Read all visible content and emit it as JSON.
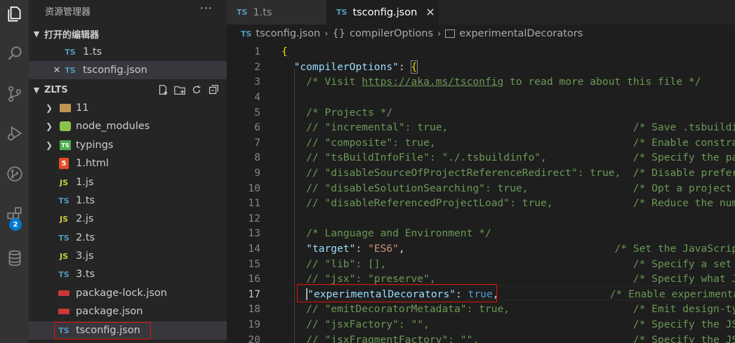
{
  "activity_bar": {
    "icons": [
      "files-icon",
      "search-icon",
      "source-control-icon",
      "run-debug-icon",
      "remote-icon",
      "extensions-icon",
      "database-icon"
    ],
    "extensions_badge": "2"
  },
  "sidebar": {
    "title": "资源管理器",
    "more": "···",
    "open_editors": {
      "title": "打开的编辑器",
      "items": [
        {
          "icon": "TS",
          "label": "1.ts"
        },
        {
          "icon": "TS",
          "label": "tsconfig.json",
          "close": "✕"
        }
      ]
    },
    "folder": {
      "title": "ZLTS",
      "items": [
        {
          "type": "folder",
          "label": "11"
        },
        {
          "type": "folder-node",
          "label": "node_modules"
        },
        {
          "type": "folder-typings",
          "label": "typings"
        },
        {
          "type": "html",
          "icon": "5",
          "label": "1.html"
        },
        {
          "type": "js",
          "icon": "JS",
          "label": "1.js"
        },
        {
          "type": "ts",
          "icon": "TS",
          "label": "1.ts"
        },
        {
          "type": "js",
          "icon": "JS",
          "label": "2.js"
        },
        {
          "type": "ts",
          "icon": "TS",
          "label": "2.ts"
        },
        {
          "type": "js",
          "icon": "JS",
          "label": "3.js"
        },
        {
          "type": "ts",
          "icon": "TS",
          "label": "3.ts"
        },
        {
          "type": "npm",
          "label": "package-lock.json"
        },
        {
          "type": "npm",
          "label": "package.json"
        },
        {
          "type": "tsconfig",
          "icon": "TS",
          "label": "tsconfig.json"
        }
      ]
    }
  },
  "tabs": [
    {
      "icon": "TS",
      "label": "1.ts",
      "active": false
    },
    {
      "icon": "TS",
      "label": "tsconfig.json",
      "active": true,
      "close": "✕"
    }
  ],
  "breadcrumb": {
    "file": "tsconfig.json",
    "object_icon": "{}",
    "object": "compilerOptions",
    "property": "experimentalDecorators",
    "sep": "›"
  },
  "editor": {
    "current_line": 17,
    "colors": {
      "comment": "#6a9955",
      "key": "#9cdcfe",
      "string": "#ce9178",
      "keyword": "#569cd6",
      "brace": "#ffd700"
    },
    "lines": [
      {
        "n": "1",
        "t": [
          [
            "{",
            "brace"
          ]
        ]
      },
      {
        "n": "2",
        "t": [
          [
            "  ",
            "p"
          ],
          [
            "\"compilerOptions\"",
            "key"
          ],
          [
            ": ",
            "p"
          ],
          [
            "{",
            "brace-box"
          ]
        ]
      },
      {
        "n": "3",
        "t": [
          [
            "    /* Visit ",
            "com"
          ],
          [
            "https://aka.ms/tsconfig",
            "link"
          ],
          [
            " to read more about this file */",
            "com"
          ]
        ]
      },
      {
        "n": "4",
        "t": []
      },
      {
        "n": "5",
        "t": [
          [
            "    /* Projects */",
            "com"
          ]
        ]
      },
      {
        "n": "6",
        "t": [
          [
            "    // \"incremental\": true,                              /* Save .tsbuildinfo files",
            "com"
          ]
        ]
      },
      {
        "n": "7",
        "t": [
          [
            "    // \"composite\": true,                                /* Enable constraints that",
            "com"
          ]
        ]
      },
      {
        "n": "8",
        "t": [
          [
            "    // \"tsBuildInfoFile\": \"./.tsbuildinfo\",              /* Specify the path to .ts",
            "com"
          ]
        ]
      },
      {
        "n": "9",
        "t": [
          [
            "    // \"disableSourceOfProjectReferenceRedirect\": true,  /* Disable preferring sour",
            "com"
          ]
        ]
      },
      {
        "n": "10",
        "t": [
          [
            "    // \"disableSolutionSearching\": true,                 /* Opt a project out of mu",
            "com"
          ]
        ]
      },
      {
        "n": "11",
        "t": [
          [
            "    // \"disableReferencedProjectLoad\": true,             /* Reduce the number of pr",
            "com"
          ]
        ]
      },
      {
        "n": "12",
        "t": []
      },
      {
        "n": "13",
        "t": [
          [
            "    /* Language and Environment */",
            "com"
          ]
        ]
      },
      {
        "n": "14",
        "t": [
          [
            "    ",
            "p"
          ],
          [
            "\"target\"",
            "key"
          ],
          [
            ": ",
            "p"
          ],
          [
            "\"ES6\"",
            "str"
          ],
          [
            ",",
            "p"
          ],
          [
            "                                  /* Set the JavaScript lang",
            "com"
          ]
        ]
      },
      {
        "n": "15",
        "t": [
          [
            "    // \"lib\": [],                                        /* Specify a set of bundle",
            "com"
          ]
        ]
      },
      {
        "n": "16",
        "t": [
          [
            "    // \"jsx\": \"preserve\",                                /* Specify what JSX code i",
            "com"
          ]
        ]
      },
      {
        "n": "17",
        "t": [
          [
            "    ",
            "p"
          ],
          [
            "|",
            "cursor"
          ],
          [
            "\"experimentalDecorators\"",
            "key"
          ],
          [
            ": ",
            "p"
          ],
          [
            "true",
            "kw"
          ],
          [
            ",",
            "p"
          ],
          [
            "                  /* Enable experimental sup",
            "com"
          ]
        ]
      },
      {
        "n": "18",
        "t": [
          [
            "    // \"emitDecoratorMetadata\": true,                    /* Emit design-type metada",
            "com"
          ]
        ]
      },
      {
        "n": "19",
        "t": [
          [
            "    // \"jsxFactory\": \"\",                                 /* Specify the JSX factory",
            "com"
          ]
        ]
      },
      {
        "n": "20",
        "t": [
          [
            "    // \"jsxFragmentFactory\": \"\",                         /* Specify the JSX Fragmen",
            "com"
          ]
        ]
      }
    ]
  }
}
